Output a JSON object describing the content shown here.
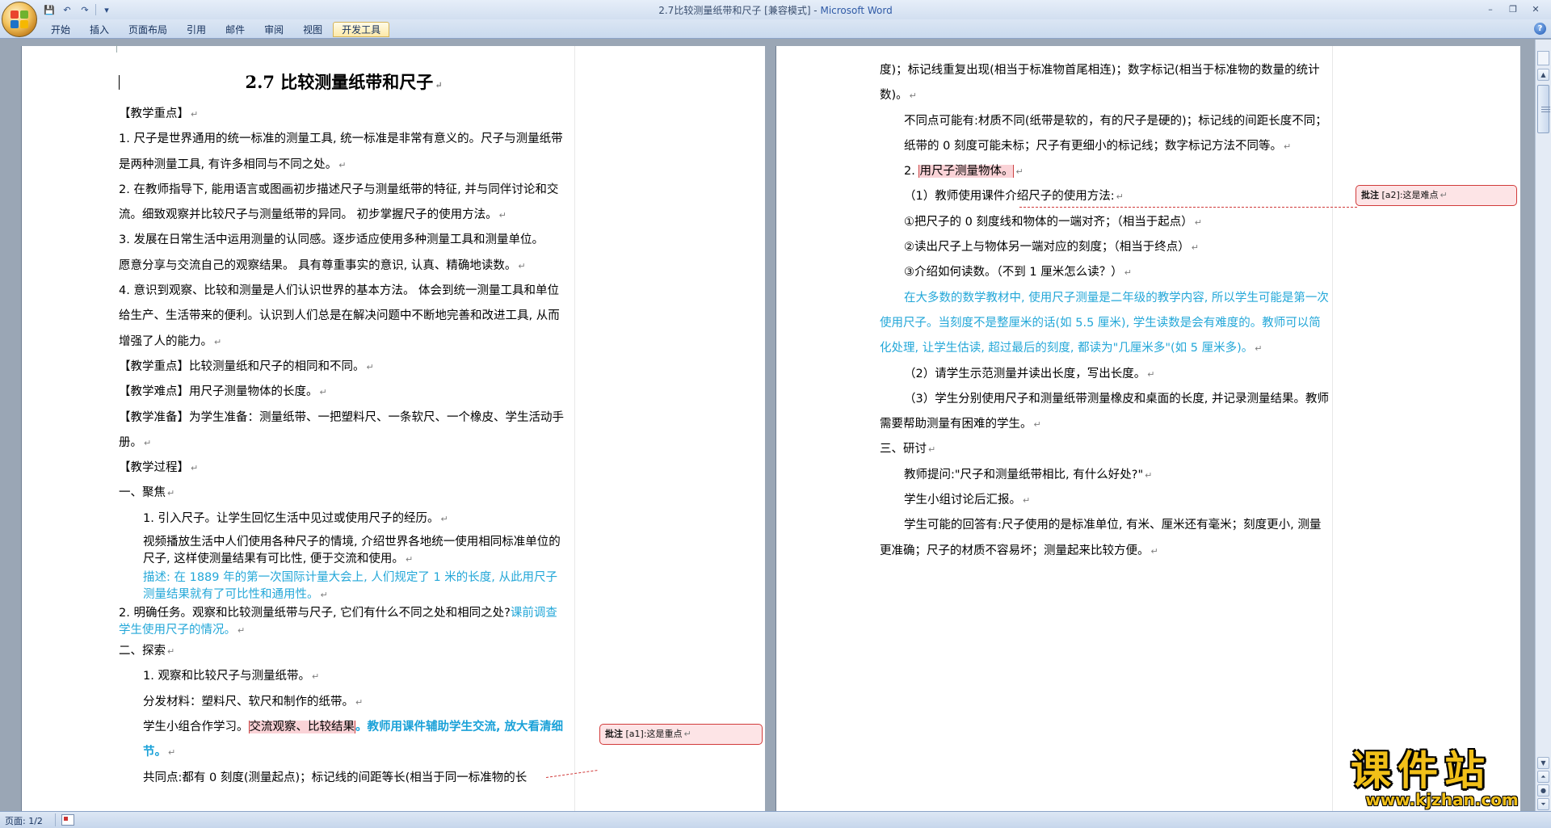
{
  "window": {
    "title_doc": "2.7比较测量纸带和尺子 [兼容模式] - ",
    "title_app": "Microsoft Word",
    "minimize": "–",
    "restore": "❐",
    "close": "✕"
  },
  "qat": {
    "save_icon": "💾",
    "undo_icon": "↶",
    "redo_icon": "↷",
    "more_icon": "▾"
  },
  "ribbon": {
    "tabs": [
      "开始",
      "插入",
      "页面布局",
      "引用",
      "邮件",
      "审阅",
      "视图",
      "开发工具"
    ],
    "active_tab": 7,
    "help": "?"
  },
  "pages": {
    "left": {
      "title": "2.7 比较测量纸带和尺子",
      "paragraphs": [
        "【教学重点】",
        "1. 尺子是世界通用的统一标准的测量工具, 统一标准是非常有意义的。尺子与测量纸带是两种测量工具, 有许多相同与不同之处。",
        "2. 在教师指导下, 能用语言或图画初步描述尺子与测量纸带的特征, 并与同伴讨论和交流。细致观察并比较尺子与测量纸带的异同。 初步掌握尺子的使用方法。",
        "3. 发展在日常生活中运用测量的认同感。逐步适应使用多种测量工具和测量单位。",
        "愿意分享与交流自己的观察结果。 具有尊重事实的意识, 认真、精确地读数。",
        "4. 意识到观察、比较和测量是人们认识世界的基本方法。 体会到统一测量工具和单位给生产、生活带来的便利。认识到人们总是在解决问题中不断地完善和改进工具, 从而增强了人的能力。",
        "【教学重点】比较测量纸和尺子的相同和不同。",
        "【教学难点】用尺子测量物体的长度。",
        "【教学准备】为学生准备：测量纸带、一把塑料尺、一条软尺、一个橡皮、学生活动手册。",
        "【教学过程】",
        "一、聚焦",
        "1. 引入尺子。让学生回忆生活中见过或使用尺子的经历。",
        "视频播放生活中人们使用各种尺子的情境, 介绍世界各地统一使用相同标准单位的尺子, 这样使测量结果有可比性, 便于交流和使用。",
        "描述: 在 1889 年的第一次国际计量大会上, 人们规定了 1 米的长度, 从此用尺子测量结果就有了可比性和通用性。",
        "2. 明确任务。观察和比较测量纸带与尺子, 它们有什么不同之处和相同之处?",
        "课前调查学生使用尺子的情况。",
        "二、探索",
        "1. 观察和比较尺子与测量纸带。",
        "分发材料：塑料尺、软尺和制作的纸带。",
        "学生小组合作学习。",
        "交流观察、比较结果",
        "。教师用课件辅助学生交流, 放大看清细节。",
        "共同点:都有 0 刻度(测量起点)；标记线的间距等长(相当于同一标准物的长"
      ]
    },
    "right": {
      "paragraphs": [
        "度)；标记线重复出现(相当于标准物首尾相连)；数字标记(相当于标准物的数量的统计数)。",
        "不同点可能有:材质不同(纸带是软的，有的尺子是硬的)；标记线的间距长度不同；纸带的 0 刻度可能未标；尺子有更细小的标记线；数字标记方法不同等。",
        "2. ",
        "用尺子测量物体。",
        "（1）教师使用课件介绍尺子的使用方法:",
        "①把尺子的 0 刻度线和物体的一端对齐；（相当于起点）",
        "②读出尺子上与物体另一端对应的刻度；（相当于终点）",
        "③介绍如何读数。（不到 1 厘米怎么读？）",
        "在大多数的数学教材中, 使用尺子测量是二年级的教学内容, 所以学生可能是第一次使用尺子。当刻度不是整厘米的话(如 5.5 厘米), 学生读数是会有难度的。教师可以简化处理, 让学生估读, 超过最后的刻度, 都读为\"几厘米多\"(如 5 厘米多)。",
        "（2）请学生示范测量并读出长度，写出长度。",
        "（3）学生分别使用尺子和测量纸带测量橡皮和桌面的长度, 并记录测量结果。教师需要帮助测量有困难的学生。",
        "三、研讨",
        "教师提问:\"尺子和测量纸带相比, 有什么好处?\"",
        "学生小组讨论后汇报。",
        "学生可能的回答有:尺子使用的是标准单位, 有米、厘米还有毫米；刻度更小, 测量更准确；尺子的材质不容易坏；测量起来比较方便。"
      ]
    },
    "paragraph_mark": "↵"
  },
  "comments": [
    {
      "label": "批注",
      "ref": " [a1]:",
      "text": "这是重点"
    },
    {
      "label": "批注",
      "ref": " [a2]:",
      "text": "这是难点"
    }
  ],
  "status": {
    "page": "页面: 1/2"
  },
  "watermark": {
    "name": "课件站",
    "url": "www.kjzhan.com"
  },
  "colors": {
    "insert_blue": "#23a7d8",
    "comment_border": "#d13b3b",
    "comment_fill": "#fde4e6",
    "highlight": "#fad3d7"
  }
}
